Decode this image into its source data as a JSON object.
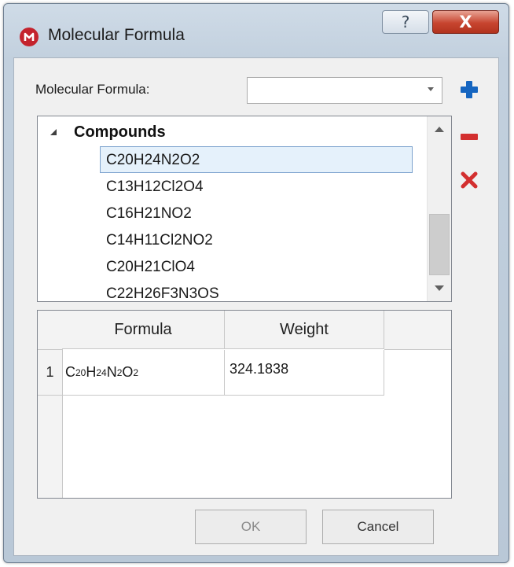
{
  "window": {
    "title": "Molecular Formula",
    "help_glyph": "?",
    "close_glyph": "X",
    "colors": {
      "close_button": "#c7452f",
      "app_icon": "#c4232d",
      "selection": "#e5f1fb"
    }
  },
  "form": {
    "label": "Molecular Formula:",
    "combo_value": ""
  },
  "side_buttons": [
    {
      "icon": "plus-icon",
      "color": "#1565c0"
    },
    {
      "icon": "minus-icon",
      "color": "#d32f2f"
    },
    {
      "icon": "delete-x-icon",
      "color": "#d32f2f"
    }
  ],
  "tree": {
    "header": "Compounds",
    "selected_index": 0,
    "items": [
      "C20H24N2O2",
      "C13H12Cl2O4",
      "C16H21NO2",
      "C14H11Cl2NO2",
      "C20H21ClO4",
      "C22H26F3N3OS"
    ]
  },
  "grid": {
    "columns": [
      "Formula",
      "Weight"
    ],
    "rows": [
      {
        "num": "1",
        "formula_parts": [
          {
            "t": "C"
          },
          {
            "s": "20"
          },
          {
            "t": "H"
          },
          {
            "s": "24"
          },
          {
            "t": "N"
          },
          {
            "s": "2"
          },
          {
            "t": "O"
          },
          {
            "s": "2"
          }
        ],
        "weight": "324.1838"
      }
    ]
  },
  "buttons": {
    "ok": "OK",
    "cancel": "Cancel"
  }
}
